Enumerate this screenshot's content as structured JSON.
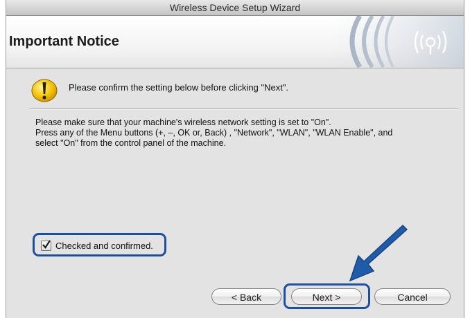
{
  "window": {
    "title": "Wireless Device Setup Wizard"
  },
  "banner": {
    "title": "Important Notice",
    "logo_icon": "wireless-signal-icon"
  },
  "notice": {
    "icon": "warning-icon",
    "text": "Please confirm the setting below before clicking \"Next\"."
  },
  "body": {
    "line1": "Please make sure that your machine's wireless network setting is set to \"On\".",
    "line2": "Press any of the Menu buttons (+, –, OK or, Back) , \"Network\", \"WLAN\", \"WLAN Enable\", and",
    "line3": "select \"On\" from the control panel of the machine."
  },
  "confirm": {
    "label": "Checked and confirmed.",
    "checked": true
  },
  "buttons": {
    "back": "< Back",
    "next": "Next >",
    "cancel": "Cancel"
  },
  "colors": {
    "highlight": "#1c4f9c",
    "arrow": "#1f5ba8",
    "warning_yellow": "#f3c200"
  }
}
